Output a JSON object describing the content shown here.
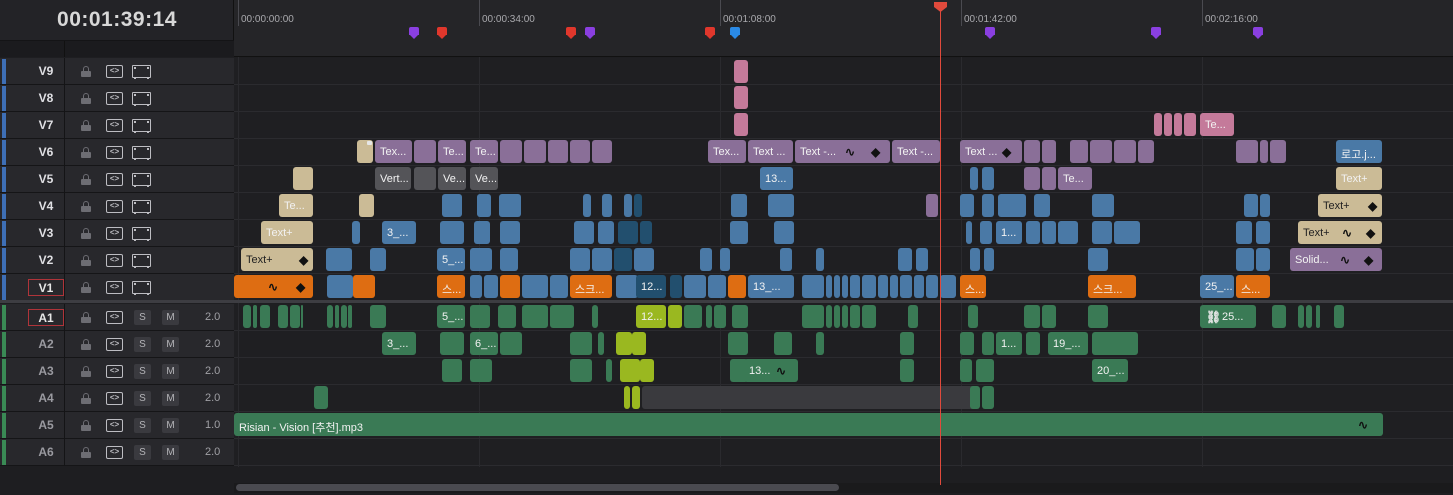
{
  "timecode": "00:01:39:14",
  "ruler": {
    "labels": [
      "00:00:00:00",
      "00:00:34:00",
      "00:01:08:00",
      "00:01:42:00",
      "00:02:16:00"
    ]
  },
  "colors": {
    "video_bar": "#4a7bc4",
    "audio_bar": "#3f8e5a",
    "playhead": "#e04a3c",
    "clip_purple": "#8a6f98",
    "clip_blue": "#4a79a6",
    "clip_orange": "#de6d12",
    "clip_green": "#3a7a55",
    "clip_lime": "#9ab820",
    "clip_tan": "#cbbb96",
    "clip_pink": "#c47a9a"
  },
  "markers": [
    {
      "color": "purple"
    },
    {
      "color": "red"
    },
    {
      "color": "red"
    },
    {
      "color": "purple"
    },
    {
      "color": "red"
    },
    {
      "color": "blue"
    },
    {
      "color": "purple"
    },
    {
      "color": "purple"
    },
    {
      "color": "purple"
    }
  ],
  "tracks": {
    "video": [
      {
        "name": "V9",
        "icons": [
          "lock-icon",
          "auto-track-icon",
          "film-icon"
        ]
      },
      {
        "name": "V8",
        "icons": [
          "lock-icon",
          "auto-track-icon",
          "film-icon"
        ]
      },
      {
        "name": "V7",
        "icons": [
          "lock-icon",
          "auto-track-icon",
          "film-icon"
        ]
      },
      {
        "name": "V6",
        "icons": [
          "lock-icon",
          "auto-track-icon",
          "film-icon"
        ]
      },
      {
        "name": "V5",
        "icons": [
          "lock-icon",
          "auto-track-icon",
          "film-icon"
        ]
      },
      {
        "name": "V4",
        "icons": [
          "lock-icon",
          "auto-track-icon",
          "film-icon"
        ]
      },
      {
        "name": "V3",
        "icons": [
          "lock-icon",
          "auto-track-icon",
          "film-icon"
        ]
      },
      {
        "name": "V2",
        "icons": [
          "lock-icon",
          "auto-track-icon",
          "film-icon"
        ]
      },
      {
        "name": "V1",
        "icons": [
          "lock-icon",
          "auto-track-icon",
          "film-icon"
        ],
        "active": true
      }
    ],
    "audio": [
      {
        "name": "A1",
        "solo": "S",
        "mute": "M",
        "volume": "2.0",
        "active": true
      },
      {
        "name": "A2",
        "solo": "S",
        "mute": "M",
        "volume": "2.0"
      },
      {
        "name": "A3",
        "solo": "S",
        "mute": "M",
        "volume": "2.0"
      },
      {
        "name": "A4",
        "solo": "S",
        "mute": "M",
        "volume": "2.0"
      },
      {
        "name": "A5",
        "solo": "S",
        "mute": "M",
        "volume": "1.0"
      },
      {
        "name": "A6",
        "solo": "S",
        "mute": "M",
        "volume": "2.0"
      }
    ]
  },
  "clips": {
    "v6": [
      "Tex...",
      "Te...",
      "Te...",
      "Tex...",
      "Text ...",
      "Text -...",
      "Text -...",
      "Text ...",
      "로고.j..."
    ],
    "v5": [
      "Vert...",
      "Ve...",
      "Ve...",
      "13...",
      "Te...",
      "Text+"
    ],
    "v4": [
      "Te...",
      "Text+"
    ],
    "v3": [
      "Text+",
      "3_...",
      "1...",
      "Text+"
    ],
    "v2": [
      "Text+",
      "5_...",
      "Solid..."
    ],
    "v7": [
      "Te..."
    ],
    "v1": [
      "스...",
      "스크...",
      "12...",
      "13_...",
      "스...",
      "스크...",
      "25_...",
      "스..."
    ],
    "a1": [
      "5_...",
      "12...",
      "25..."
    ],
    "a2": [
      "3_...",
      "6_...",
      "1...",
      "19_..."
    ],
    "a3": [
      "13...",
      "20_..."
    ],
    "a5": [
      "Risian - Vision [추천].mp3"
    ]
  }
}
